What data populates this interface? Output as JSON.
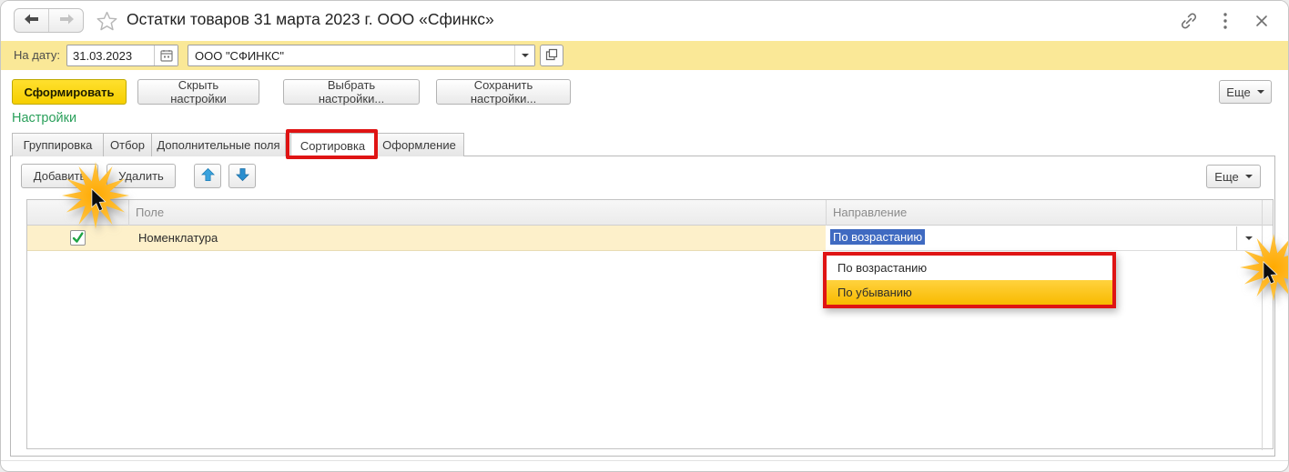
{
  "window": {
    "title": "Остатки товаров 31 марта 2023 г. ООО «Сфинкс»"
  },
  "icons": {
    "back": "arrow-left",
    "forward": "arrow-right",
    "favorite": "star-outline",
    "link": "chain-link",
    "window_more": "vertical-dots",
    "close": "x-cross",
    "calendar": "calendar-grid",
    "combo_arrow": "triangle-down",
    "org_open": "overlapping-squares",
    "move_up": "blue-arrow-up",
    "move_down": "blue-arrow-down",
    "checkbox": "green-checkmark",
    "click_effect": "orange-starburst-with-cursor"
  },
  "filter_bar": {
    "date_label": "На дату:",
    "date_value": "31.03.2023",
    "org_value": "ООО \"СФИНКС\""
  },
  "actions": {
    "generate": "Сформировать",
    "hide_settings": "Скрыть настройки",
    "select_settings": "Выбрать настройки...",
    "save_settings": "Сохранить настройки...",
    "more": "Еще"
  },
  "settings": {
    "title": "Настройки",
    "tabs": [
      {
        "label": "Группировка",
        "active": false
      },
      {
        "label": "Отбор",
        "active": false
      },
      {
        "label": "Дополнительные поля",
        "active": false
      },
      {
        "label": "Сортировка",
        "active": true,
        "annotated_red": true
      },
      {
        "label": "Оформление",
        "active": false
      }
    ],
    "toolbar": {
      "add": "Добавить",
      "remove": "Удалить",
      "more": "Еще"
    },
    "table": {
      "columns": [
        "Поле",
        "Направление"
      ],
      "rows": [
        {
          "checked": true,
          "field": "Номенклатура",
          "direction": "По возрастанию",
          "direction_text_selected": true
        }
      ]
    },
    "direction_dropdown": {
      "annotated_red": true,
      "options": [
        {
          "label": "По возрастанию",
          "highlighted": false
        },
        {
          "label": "По убыванию",
          "highlighted": true
        }
      ]
    }
  },
  "colors": {
    "filter_bar_yellow": "#fae897",
    "generate_button_yellow": "#f6cf00",
    "row_selected_yellow": "#fdf0ca",
    "dropdown_highlight_amber": "#f8ba00",
    "annotation_red": "#df1414",
    "text_selection_blue": "#3f6ac1",
    "settings_title_green": "#2aa05b",
    "toolbar_arrow_blue": "#2e97d5"
  }
}
